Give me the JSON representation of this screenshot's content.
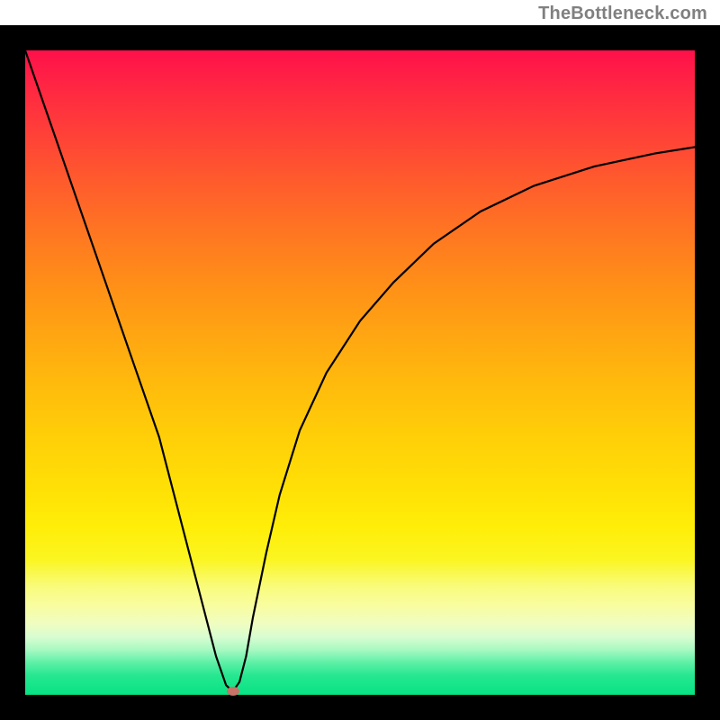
{
  "meta": {
    "watermark_text": "TheBottleneck.com",
    "colors": {
      "frame": "#000000",
      "curve": "#000000",
      "marker": "#C77367",
      "gradient_top": "#FF104A",
      "gradient_bottom": "#07E383"
    }
  },
  "chart_data": {
    "type": "line",
    "title": "",
    "xlabel": "",
    "ylabel": "",
    "xlim": [
      0,
      100
    ],
    "ylim": [
      0,
      100
    ],
    "series": [
      {
        "name": "bottleneck-curve",
        "x": [
          0,
          4,
          8,
          12,
          16,
          20,
          23,
          26,
          28.5,
          30,
          31,
          32,
          33,
          34,
          36,
          38,
          41,
          45,
          50,
          55,
          61,
          68,
          76,
          85,
          94,
          100
        ],
        "y": [
          100,
          88,
          76,
          64,
          52,
          40,
          28,
          16,
          6,
          1.5,
          0.5,
          2,
          6,
          12,
          22,
          31,
          41,
          50,
          58,
          64,
          70,
          75,
          79,
          82,
          84,
          85
        ]
      }
    ],
    "marker": {
      "x": 31,
      "y": 0.5,
      "name": "optimal-point"
    },
    "annotations": []
  }
}
